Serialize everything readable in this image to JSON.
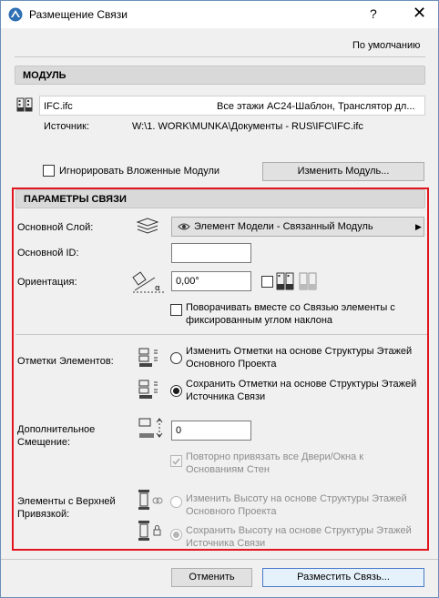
{
  "window": {
    "title": "Размещение Связи",
    "help": "?",
    "close": "✕"
  },
  "defaults_link": "По умолчанию",
  "module": {
    "header": "МОДУЛЬ",
    "file_name": "IFC.ifc",
    "file_desc": "Все этажи AC24-Шаблон, Транслятор дл...",
    "source_label": "Источник:",
    "source_path": "W:\\1. WORK\\MUNKA\\Документы - RUS\\IFC\\IFC.ifc",
    "ignore_nested_label": "Игнорировать Вложенные Модули",
    "change_module_button": "Изменить Модуль..."
  },
  "link_params": {
    "header": "ПАРАМЕТРЫ СВЯЗИ",
    "base_layer_label": "Основной Слой:",
    "base_layer_value": "Элемент Модели - Связанный Модуль",
    "base_id_label": "Основной ID:",
    "base_id_value": "",
    "orientation_label": "Ориентация:",
    "orientation_value": "0,00°",
    "rotate_fixed_label_1": "Поворачивать вместе со Связью элементы с",
    "rotate_fixed_label_2": "фиксированным углом наклона",
    "elevations_label": "Отметки Элементов:",
    "elev_opt1_line1": "Изменить Отметки на основе Структуры Этажей",
    "elev_opt1_line2": "Основного Проекта",
    "elev_opt2_line1": "Сохранить Отметки на основе Структуры Этажей",
    "elev_opt2_line2": "Источника Связи",
    "extra_offset_label_1": "Дополнительное",
    "extra_offset_label_2": "Смещение:",
    "extra_offset_value": "0",
    "rebind_label_1": "Повторно привязать все Двери/Окна к",
    "rebind_label_2": "Основаниям Стен",
    "top_linked_label_1": "Элементы с Верхней",
    "top_linked_label_2": "Привязкой:",
    "top_opt1_line1": "Изменить Высоту на основе Структуры Этажей",
    "top_opt1_line2": "Основного Проекта",
    "top_opt2_line1": "Сохранить Высоту на основе Структуры Этажей",
    "top_opt2_line2": "Источника Связи"
  },
  "footer": {
    "cancel_button": "Отменить",
    "place_button": "Разместить Связь..."
  }
}
